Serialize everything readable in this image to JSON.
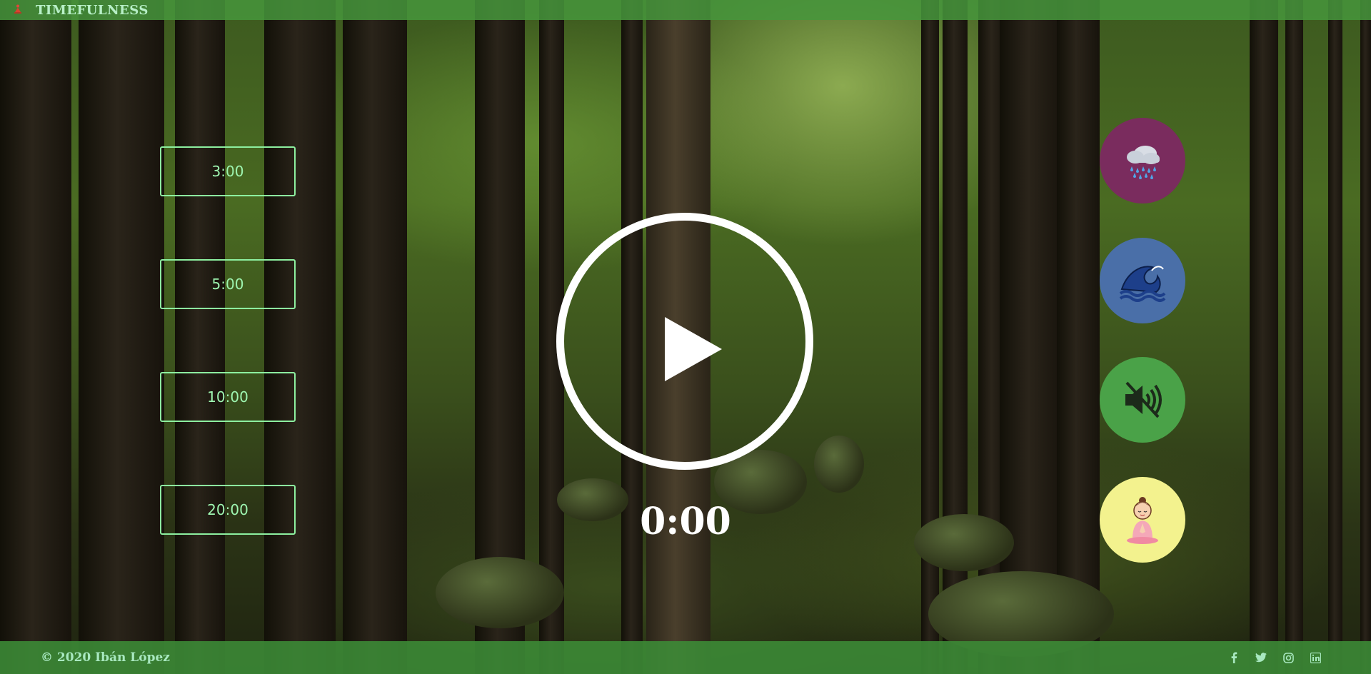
{
  "header": {
    "brand_icon": "meditation-icon",
    "title": "TIMEFULNESS"
  },
  "timer_options": [
    {
      "label": "3:00"
    },
    {
      "label": "5:00"
    },
    {
      "label": "10:00"
    },
    {
      "label": "20:00"
    }
  ],
  "player": {
    "icon": "play-icon",
    "time": "0:00"
  },
  "sounds": [
    {
      "icon": "rain-cloud-icon",
      "color": "#7a2c5e"
    },
    {
      "icon": "wave-icon",
      "color": "#4a6fa8"
    },
    {
      "icon": "speaker-muted-icon",
      "color": "#4aa248"
    },
    {
      "icon": "meditating-person-icon",
      "color": "#f3f28e"
    }
  ],
  "footer": {
    "copyright": "© 2020 Ibán López",
    "socials": [
      "facebook-icon",
      "twitter-icon",
      "instagram-icon",
      "linkedin-icon"
    ],
    "accent": "#a8e8c0"
  }
}
